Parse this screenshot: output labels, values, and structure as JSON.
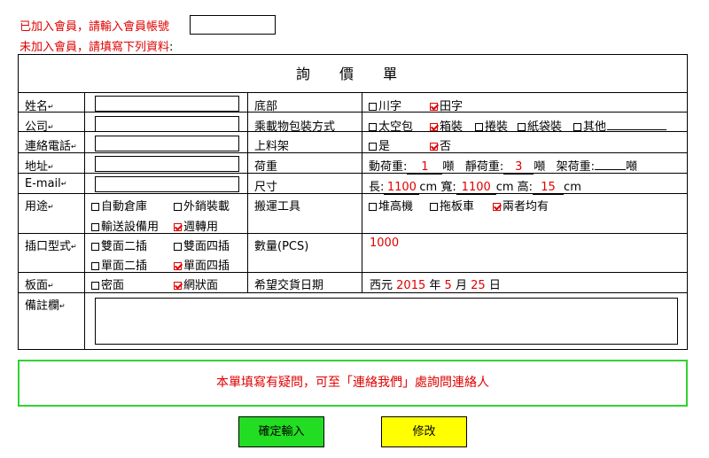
{
  "member": {
    "joined_label": "已加入會員，請輸入會員帳號",
    "not_joined_label": "未加入會員，請填寫下列資料",
    "not_joined_colon": ":",
    "account_value": ""
  },
  "form": {
    "title": "詢 價 單",
    "fields": {
      "name": "姓名",
      "company": "公司",
      "phone": "連絡電話",
      "address": "地址",
      "email": "E-mail",
      "usage": "用途",
      "socket_type": "插口型式",
      "panel": "板面",
      "remarks": "備註欄",
      "edit_marker": "↵"
    },
    "usage_options": [
      {
        "label": "自動倉庫",
        "checked": false
      },
      {
        "label": "外銷裝載",
        "checked": false
      },
      {
        "label": "輸送設備用",
        "checked": false
      },
      {
        "label": "週轉用",
        "checked": true
      }
    ],
    "socket_options": [
      {
        "label": "雙面二插",
        "checked": false
      },
      {
        "label": "雙面四插",
        "checked": false
      },
      {
        "label": "單面二插",
        "checked": false
      },
      {
        "label": "單面四插",
        "checked": true
      }
    ],
    "panel_options": [
      {
        "label": "密面",
        "checked": false
      },
      {
        "label": "網狀面",
        "checked": true
      }
    ],
    "bottom": {
      "label": "底部",
      "options": [
        {
          "label": "川字",
          "checked": false
        },
        {
          "label": "田字",
          "checked": true
        }
      ]
    },
    "packaging": {
      "label": "乘載物包裝方式",
      "options": [
        {
          "label": "太空包",
          "checked": false
        },
        {
          "label": "箱裝",
          "checked": true
        },
        {
          "label": "捲裝",
          "checked": false
        },
        {
          "label": "紙袋裝",
          "checked": false
        },
        {
          "label": "其他",
          "checked": false
        }
      ]
    },
    "rack": {
      "label": "上料架",
      "options": [
        {
          "label": "是",
          "checked": false
        },
        {
          "label": "否",
          "checked": true
        }
      ]
    },
    "load": {
      "label": "荷重",
      "dynamic_label": "動荷重:",
      "dynamic_value": "1",
      "static_label": "靜荷重:",
      "static_value": "3",
      "rack_label": "架荷重:",
      "rack_value": "",
      "unit": "噸"
    },
    "size": {
      "label": "尺寸",
      "length_label": "長:",
      "length_value": "1100",
      "width_label": "cm 寬:",
      "width_value": "1100",
      "height_label": "cm 高:",
      "height_value": "15",
      "unit": "cm"
    },
    "handling": {
      "label": "搬運工具",
      "options": [
        {
          "label": "堆高機",
          "checked": false
        },
        {
          "label": "拖板車",
          "checked": false
        },
        {
          "label": "兩者均有",
          "checked": true
        }
      ]
    },
    "quantity": {
      "label": "數量(PCS)",
      "value": "1000"
    },
    "delivery": {
      "label": "希望交貨日期",
      "era": "西元",
      "year": "2015",
      "year_unit": "年",
      "month": "5",
      "month_unit": "月",
      "day": "25",
      "day_unit": "日"
    }
  },
  "notice": "本單填寫有疑問，可至「連絡我們」處詢問連絡人",
  "buttons": {
    "confirm": "確定輸入",
    "modify": "修改"
  },
  "colors": {
    "red_text": "#e00000",
    "notice_border": "#32d332",
    "confirm_bg": "#22dd22",
    "modify_bg": "#ffff00"
  }
}
